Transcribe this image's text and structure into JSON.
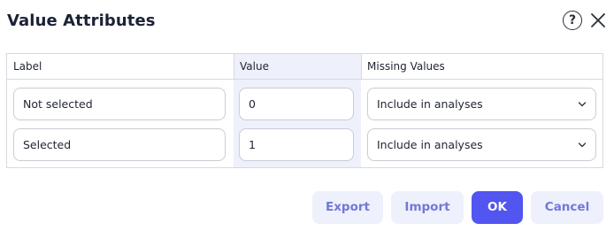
{
  "dialog": {
    "title": "Value Attributes",
    "help_icon": "question-circle-icon",
    "close_icon": "close-icon"
  },
  "table": {
    "headers": {
      "label": "Label",
      "value": "Value",
      "missing": "Missing Values"
    },
    "rows": [
      {
        "label": "Not selected",
        "value": "0",
        "missing": "Include in analyses"
      },
      {
        "label": "Selected",
        "value": "1",
        "missing": "Include in analyses"
      }
    ]
  },
  "buttons": {
    "export": "Export",
    "import": "Import",
    "ok": "OK",
    "cancel": "Cancel"
  },
  "colors": {
    "primary": "#5255f0",
    "secondary_bg": "#eef0fb",
    "secondary_text": "#7178d8"
  }
}
